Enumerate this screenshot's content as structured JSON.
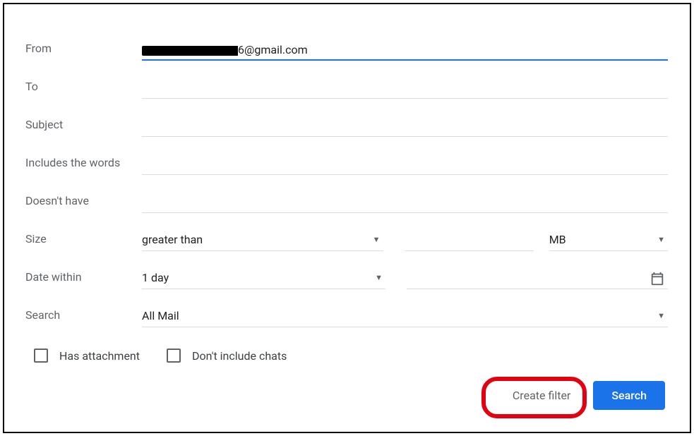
{
  "labels": {
    "from": "From",
    "to": "To",
    "subject": "Subject",
    "includes": "Includes the words",
    "doesnt": "Doesn't have",
    "size": "Size",
    "date_within": "Date within",
    "search": "Search"
  },
  "fields": {
    "from_suffix": "6@gmail.com",
    "to": "",
    "subject": "",
    "includes": "",
    "doesnt": "",
    "size_comparator": "greater than",
    "size_value": "",
    "size_unit": "MB",
    "date_range": "1 day",
    "date_of": "",
    "search_scope": "All Mail"
  },
  "checkboxes": {
    "has_attachment": "Has attachment",
    "exclude_chats": "Don't include chats"
  },
  "buttons": {
    "create_filter": "Create filter",
    "search": "Search"
  }
}
